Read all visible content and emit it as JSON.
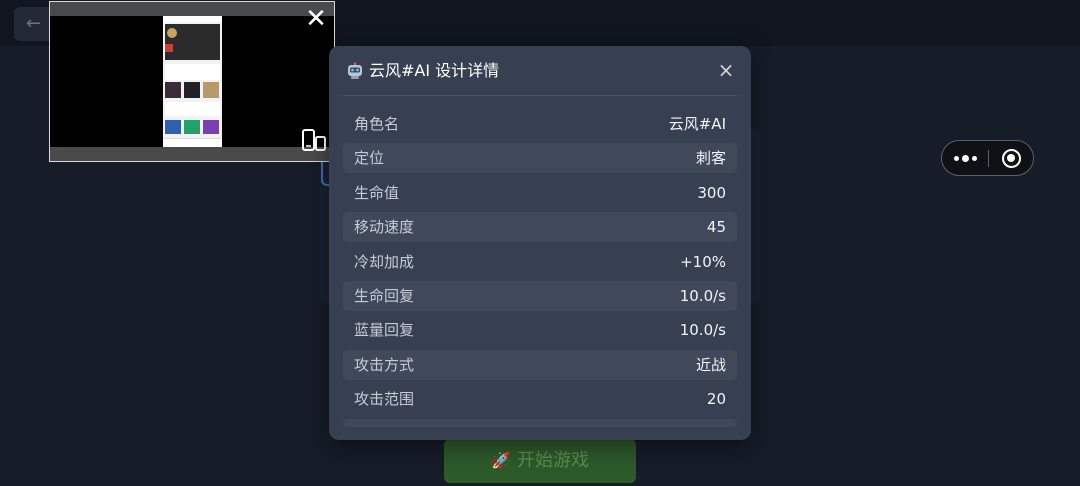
{
  "background": {
    "back_icon": "arrow-left-icon",
    "start_button": {
      "icon": "rocket-icon",
      "label": "开始游戏"
    }
  },
  "capsule": {
    "more_icon": "more-dots-icon",
    "close_icon": "record-target-icon"
  },
  "preview": {
    "close_icon": "close-icon",
    "device_icon": "device-switch-icon"
  },
  "modal": {
    "icon": "robot-icon",
    "title": "云风#AI 设计详情",
    "close_label": "×",
    "stats": [
      {
        "label": "角色名",
        "value": "云风#AI"
      },
      {
        "label": "定位",
        "value": "刺客"
      },
      {
        "label": "生命值",
        "value": "300"
      },
      {
        "label": "移动速度",
        "value": "45"
      },
      {
        "label": "冷却加成",
        "value": "+10%"
      },
      {
        "label": "生命回复",
        "value": "10.0/s"
      },
      {
        "label": "蓝量回复",
        "value": "10.0/s"
      },
      {
        "label": "攻击方式",
        "value": "近战"
      },
      {
        "label": "攻击范围",
        "value": "20"
      }
    ]
  },
  "colors": {
    "page_bg": "#161c28",
    "modal_bg": "#364050",
    "row_alt_bg": "#3f4959",
    "start_button_bg": "#2d5a2b"
  }
}
